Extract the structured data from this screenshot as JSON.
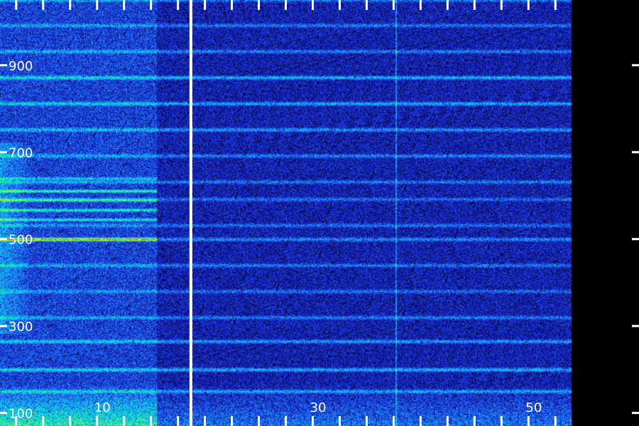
{
  "chart_data": {
    "type": "heatmap",
    "title": "",
    "xlabel": "",
    "ylabel": "",
    "x_tick_labels": [
      {
        "text": "10",
        "value": 10
      },
      {
        "text": "30",
        "value": 30
      },
      {
        "text": "50",
        "value": 50
      }
    ],
    "y_tick_labels": [
      {
        "text": "900",
        "value": 900
      },
      {
        "text": "700",
        "value": 700
      },
      {
        "text": "500",
        "value": 500
      },
      {
        "text": "300",
        "value": 300
      },
      {
        "text": "100",
        "value": 100
      }
    ],
    "xlim": [
      0.5,
      53.5
    ],
    "ylim": [
      70,
      1050
    ],
    "x_tick_step": 2.5,
    "grid": false,
    "colormap": [
      "#000000",
      "#0b0b7a",
      "#1a2bd6",
      "#1f8cff",
      "#00e6e6",
      "#33ff66",
      "#ffff00",
      "#ff3300"
    ],
    "marker_line": {
      "x": 18.2,
      "color": "#ffffff"
    },
    "faint_vertical_line": {
      "x": 37.2,
      "color": "#33ff66"
    },
    "horizontal_bands": [
      {
        "y": 1050,
        "strength": 0.5
      },
      {
        "y": 992,
        "strength": 0.55
      },
      {
        "y": 932,
        "strength": 0.6
      },
      {
        "y": 872,
        "strength": 0.85
      },
      {
        "y": 812,
        "strength": 0.8
      },
      {
        "y": 752,
        "strength": 0.7
      },
      {
        "y": 692,
        "strength": 0.6
      },
      {
        "y": 632,
        "strength": 0.55
      },
      {
        "y": 592,
        "strength": 0.5
      },
      {
        "y": 532,
        "strength": 0.5
      },
      {
        "y": 500,
        "strength": 0.65
      },
      {
        "y": 440,
        "strength": 0.55
      },
      {
        "y": 380,
        "strength": 0.5
      },
      {
        "y": 320,
        "strength": 0.55
      },
      {
        "y": 265,
        "strength": 0.75
      },
      {
        "y": 200,
        "strength": 0.85
      },
      {
        "y": 150,
        "strength": 0.7
      }
    ],
    "early_segment_lines": [
      {
        "y": 500,
        "strength": 1.0
      },
      {
        "y": 545,
        "strength": 0.7
      },
      {
        "y": 567,
        "strength": 0.75
      },
      {
        "y": 590,
        "strength": 0.6
      },
      {
        "y": 611,
        "strength": 0.85
      },
      {
        "y": 640,
        "strength": 0.5
      }
    ],
    "early_segment_end_x": 15.0
  },
  "colors": {
    "background": "#000000",
    "tick_color": "#ffffff",
    "label_color": "#ffffff"
  }
}
